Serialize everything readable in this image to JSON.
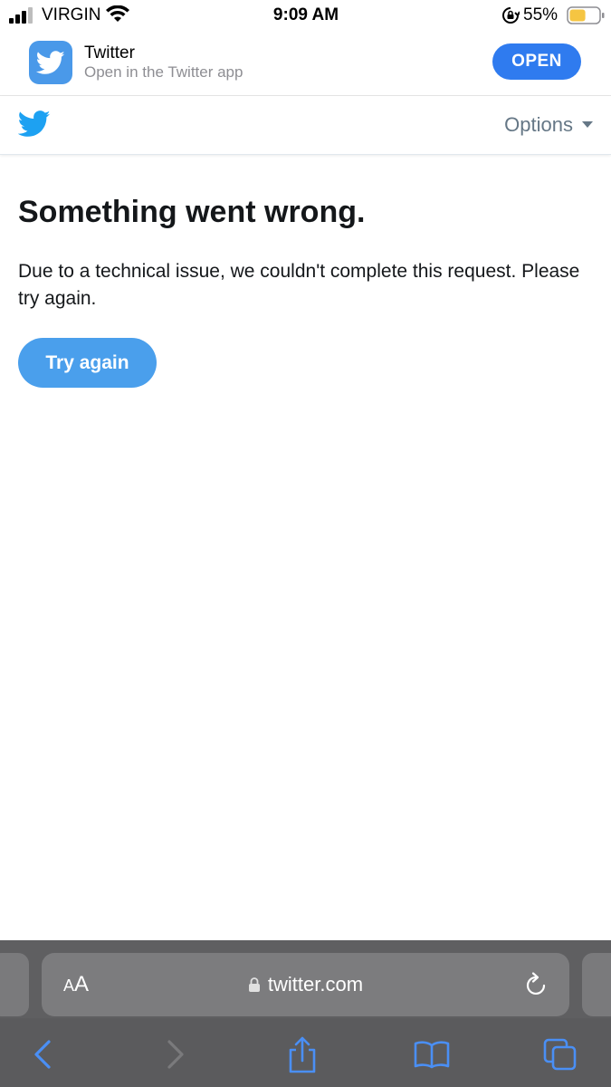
{
  "status_bar": {
    "carrier": "VIRGIN",
    "time": "9:09 AM",
    "battery_percent": "55%",
    "battery_level": 0.55,
    "battery_color": "#f5c542"
  },
  "app_banner": {
    "app_name": "Twitter",
    "subtitle": "Open in the Twitter app",
    "open_label": "OPEN",
    "accent": "#2f7bef"
  },
  "header": {
    "logo_icon": "twitter-bird-icon",
    "options_label": "Options",
    "brand_color": "#1da1f2"
  },
  "error": {
    "title": "Something went wrong.",
    "message": "Due to a technical issue, we couldn't complete this request. Please try again.",
    "retry_label": "Try again"
  },
  "safari": {
    "text_size_small": "A",
    "text_size_large": "A",
    "url": "twitter.com",
    "toolbar_icons": [
      "back-icon",
      "forward-icon",
      "share-icon",
      "bookmarks-icon",
      "tabs-icon"
    ],
    "icon_color": "#4a8ff5"
  }
}
